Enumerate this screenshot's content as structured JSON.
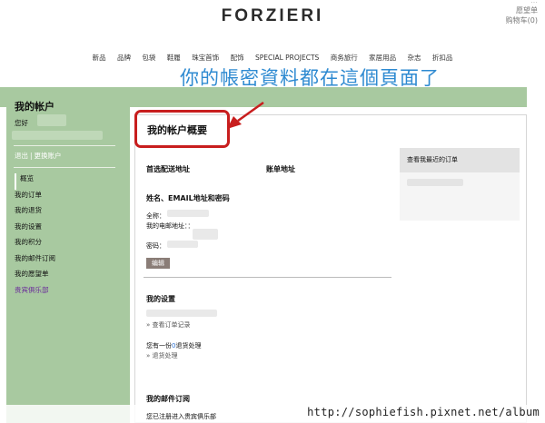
{
  "header": {
    "top_right_links": [
      "愿望单",
      "购物车(0)"
    ],
    "faded_text": "…",
    "logo": "FORZIERI",
    "nav": [
      "新品",
      "品牌",
      "包袋",
      "鞋履",
      "珠宝首饰",
      "配饰",
      "SPECIAL PROJECTS",
      "商务旅行",
      "家居用品",
      "杂志",
      "折扣品"
    ]
  },
  "annotation": {
    "text": "你的帳密資料都在這個頁面了",
    "color": "#2e8ad1",
    "highlight_color": "#c81e1e"
  },
  "sidebar": {
    "title": "我的帐户",
    "hello": "您好",
    "logout": "退出",
    "separator": "|",
    "switch_account": "更换账户",
    "menu": [
      "概览",
      "我的订单",
      "我的退货",
      "我的设置",
      "我的积分",
      "我的邮件订阅",
      "我的愿望单",
      "贵宾俱乐部"
    ],
    "bg_color": "#a8c9a0"
  },
  "main": {
    "title": "我的帐户概要",
    "preferred_address": "首选配送地址",
    "billing_address": "账单地址",
    "credentials_heading": "姓名、EMAIL地址和密码",
    "full_name_label": "全称：",
    "email_label": "我的电邮地址：：",
    "password_label": "密码：",
    "edit_button": "编辑",
    "settings_heading": "我的设置",
    "view_orders": "» 查看订单记录",
    "returns_prefix": "您有一份",
    "returns_count": "0",
    "returns_suffix": "退货处理",
    "returns_link": "» 退货处理",
    "newsletter_heading": "我的邮件订阅",
    "newsletter_text": "您已注册进入贵宾俱乐部"
  },
  "orders_panel": {
    "heading": "查看我最近的订单"
  },
  "watermark": "http://sophiefish.pixnet.net/album"
}
